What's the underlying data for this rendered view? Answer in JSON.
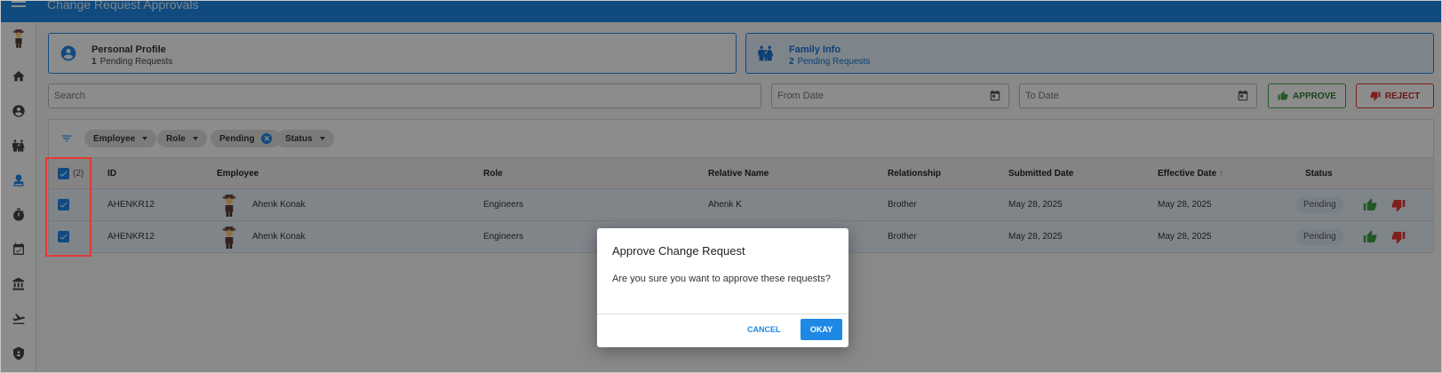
{
  "app": {
    "title": "Change Request Approvals"
  },
  "sidebar": {
    "items": [
      {
        "icon": "avatar-icon"
      },
      {
        "icon": "home-icon"
      },
      {
        "icon": "account-circle-icon"
      },
      {
        "icon": "family-icon"
      },
      {
        "icon": "approval-stamp-icon"
      },
      {
        "icon": "timer-icon"
      },
      {
        "icon": "calendar-check-icon"
      },
      {
        "icon": "bank-icon"
      },
      {
        "icon": "flight-takeoff-icon"
      },
      {
        "icon": "shield-icon"
      }
    ]
  },
  "cards": [
    {
      "title": "Personal Profile",
      "count": "1",
      "label": "Pending Requests",
      "icon": "account-circle-icon"
    },
    {
      "title": "Family Info",
      "count": "2",
      "label": "Pending Requests",
      "icon": "family-icon"
    }
  ],
  "filters": {
    "search_placeholder": "Search",
    "from_date_placeholder": "From Date",
    "to_date_placeholder": "To Date",
    "approve_label": "APPROVE",
    "reject_label": "REJECT"
  },
  "chips": [
    {
      "label": "Employee",
      "kind": "dropdown"
    },
    {
      "label": "Role",
      "kind": "dropdown"
    },
    {
      "label": "Pending",
      "kind": "removable"
    },
    {
      "label": "Status",
      "kind": "dropdown"
    }
  ],
  "table": {
    "selected_count": "(2)",
    "headers": {
      "id": "ID",
      "employee": "Employee",
      "role": "Role",
      "relative_name": "Relative Name",
      "relationship": "Relationship",
      "submitted_date": "Submitted Date",
      "effective_date": "Effective Date",
      "status": "Status"
    },
    "sort_indicator": "↑",
    "rows": [
      {
        "id": "AHENKR12",
        "employee": "Ahenk Konak",
        "role": "Engineers",
        "relative_name": "Ahenk K",
        "relationship": "Brother",
        "submitted_date": "May 28, 2025",
        "effective_date": "May 28, 2025",
        "status": "Pending",
        "checked": true
      },
      {
        "id": "AHENKR12",
        "employee": "Ahenk Konak",
        "role": "Engineers",
        "relative_name": "",
        "relationship": "Brother",
        "submitted_date": "May 28, 2025",
        "effective_date": "May 28, 2025",
        "status": "Pending",
        "checked": true
      }
    ]
  },
  "dialog": {
    "title": "Approve Change Request",
    "message": "Are you sure you want to approve these requests?",
    "cancel_label": "CANCEL",
    "okay_label": "OKAY"
  },
  "colors": {
    "primary": "#1e88e5",
    "approve": "#43a047",
    "reject": "#e53935",
    "highlight": "#e53935"
  }
}
